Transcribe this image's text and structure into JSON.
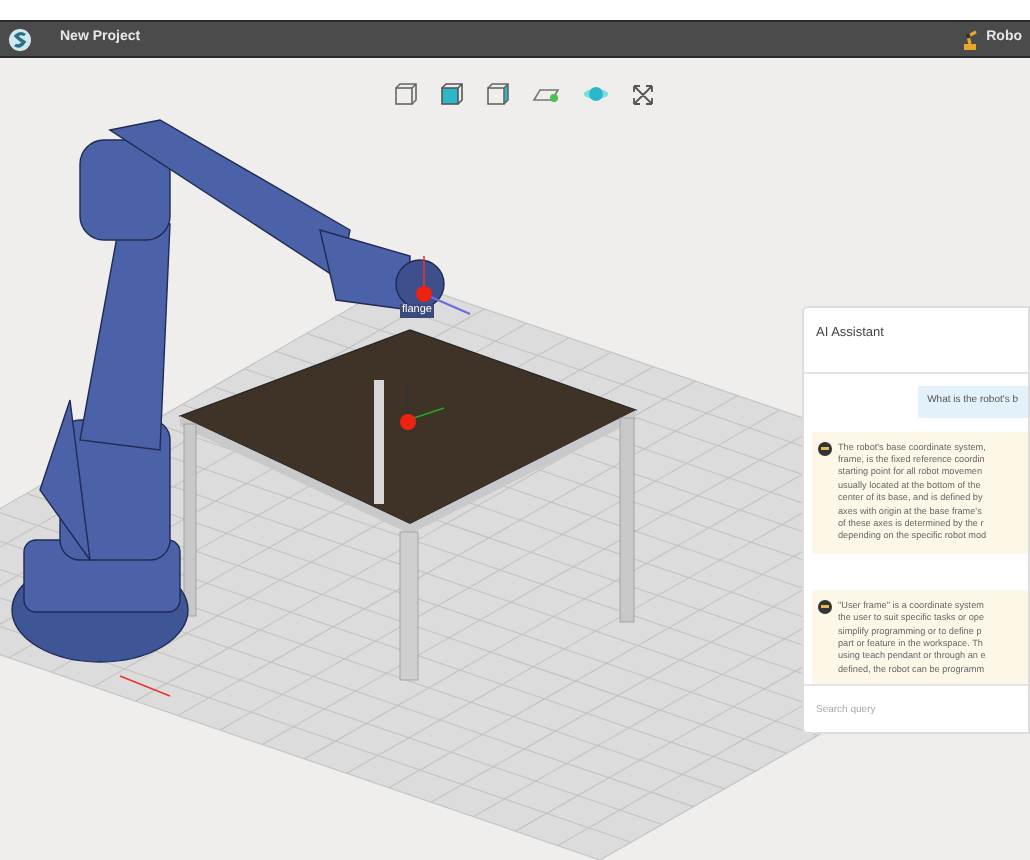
{
  "header": {
    "title": "New Project",
    "user": "Robo"
  },
  "toolbar": [
    {
      "kind": "cube-outline"
    },
    {
      "kind": "cube-front"
    },
    {
      "kind": "cube-side"
    },
    {
      "kind": "plane"
    },
    {
      "kind": "orbit"
    },
    {
      "kind": "expand"
    }
  ],
  "scene": {
    "frame_label": "flange"
  },
  "assistant": {
    "title": "AI Assistant",
    "messages": [
      {
        "kind": "user",
        "lines": [
          "What is the robot's b"
        ]
      },
      {
        "kind": "bot",
        "lines": [
          "The robot's base coordinate system,",
          "frame, is the fixed reference coordin",
          "starting point for all robot movemen",
          "usually located at the bottom of the",
          "center of its base, and is defined by",
          "axes with origin at the base frame's",
          "of these axes is determined by the r",
          "depending on the specific robot mod"
        ]
      },
      {
        "kind": "bot",
        "lines": [
          "\"User frame\" is a coordinate system",
          "the user to suit specific tasks or ope",
          "simplify programming or to define p",
          "part or feature in the workspace. Th",
          "using teach pendant or through an e",
          "defined, the robot can be programm"
        ]
      }
    ],
    "search": {
      "placeholder": "Search query"
    }
  }
}
